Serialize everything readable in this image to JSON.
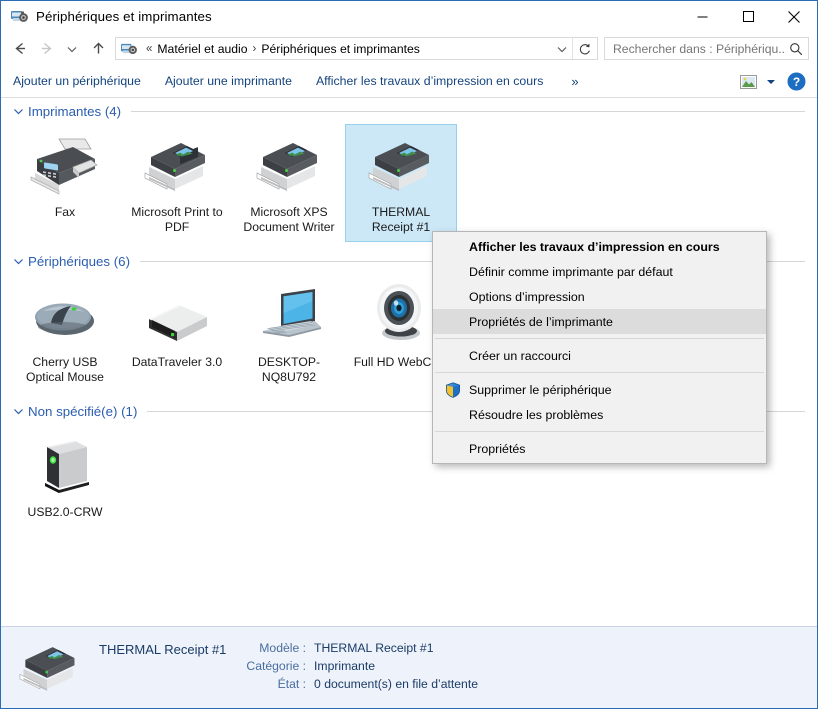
{
  "window": {
    "title": "Périphériques et imprimantes",
    "icon": "devices-printers-icon",
    "minimize_label": "—",
    "maximize_label": "☐",
    "close_label": "✕"
  },
  "nav": {
    "back_label": "←",
    "forward_label": "→",
    "recent_label": "∨",
    "up_label": "↑"
  },
  "address": {
    "icon": "devices-printers-icon",
    "prefix": "«",
    "crumb1": "Matériel et audio",
    "sep": "›",
    "crumb2": "Périphériques et imprimantes",
    "dropdown": "∨",
    "refresh": "↻"
  },
  "search": {
    "placeholder": "Rechercher dans : Périphériqu...",
    "value": "",
    "icon": "search-icon"
  },
  "toolbar": {
    "add_device": "Ajouter un périphérique",
    "add_printer": "Ajouter une imprimante",
    "view_print_jobs": "Afficher les travaux d’impression en cours",
    "overflow": "»",
    "view_dropdown": "▾",
    "help": "?"
  },
  "groups": [
    {
      "name": "printers",
      "title": "Imprimantes (4)",
      "chevron": "∨",
      "items": [
        {
          "label": "Fax",
          "icon": "fax-printer-icon",
          "selected": false
        },
        {
          "label": "Microsoft Print to PDF",
          "icon": "printer-icon",
          "selected": false
        },
        {
          "label": "Microsoft XPS Document Writer",
          "icon": "printer-icon",
          "selected": false
        },
        {
          "label": "THERMAL Receipt #1",
          "icon": "printer-icon",
          "selected": true
        }
      ]
    },
    {
      "name": "devices",
      "title": "Périphériques (6)",
      "chevron": "∨",
      "items": [
        {
          "label": "Cherry USB Optical Mouse",
          "icon": "mouse-icon",
          "selected": false
        },
        {
          "label": "DataTraveler 3.0",
          "icon": "usb-drive-icon",
          "selected": false
        },
        {
          "label": "DESKTOP-NQ8U792",
          "icon": "laptop-icon",
          "selected": false
        },
        {
          "label": "Full HD WebCam",
          "icon": "webcam-icon",
          "selected": false
        }
      ]
    },
    {
      "name": "unspecified",
      "title": "Non spécifié(e) (1)",
      "chevron": "∨",
      "items": [
        {
          "label": "USB2.0-CRW",
          "icon": "card-reader-icon",
          "selected": false
        }
      ]
    }
  ],
  "context_menu": {
    "items": [
      {
        "label": "Afficher les travaux d’impression en cours",
        "bold": true,
        "hot": false,
        "shield": false,
        "sep_after": false
      },
      {
        "label": "Définir comme imprimante par défaut",
        "bold": false,
        "hot": false,
        "shield": false,
        "sep_after": false
      },
      {
        "label": "Options d’impression",
        "bold": false,
        "hot": false,
        "shield": false,
        "sep_after": false
      },
      {
        "label": "Propriétés de l’imprimante",
        "bold": false,
        "hot": true,
        "shield": false,
        "sep_after": true
      },
      {
        "label": "Créer un raccourci",
        "bold": false,
        "hot": false,
        "shield": false,
        "sep_after": true
      },
      {
        "label": "Supprimer le périphérique",
        "bold": false,
        "hot": false,
        "shield": true,
        "sep_after": false
      },
      {
        "label": "Résoudre les problèmes",
        "bold": false,
        "hot": false,
        "shield": false,
        "sep_after": true
      },
      {
        "label": "Propriétés",
        "bold": false,
        "hot": false,
        "shield": false,
        "sep_after": false
      }
    ]
  },
  "status": {
    "icon": "printer-icon",
    "name": "THERMAL Receipt #1",
    "fields": [
      {
        "key": "Modèle :",
        "value": "THERMAL Receipt #1"
      },
      {
        "key": "Catégorie :",
        "value": "Imprimante"
      },
      {
        "key": "État :",
        "value": "0 document(s) en file d’attente"
      }
    ]
  },
  "colors": {
    "window_border": "#2b6cb5",
    "selection": "#cce8f7",
    "group_title": "#2a5db0",
    "command_link": "#13437e",
    "status_bg": "#eef3fb",
    "menu_bg": "#f1f1f1",
    "menu_hot": "#dcdcdc"
  }
}
